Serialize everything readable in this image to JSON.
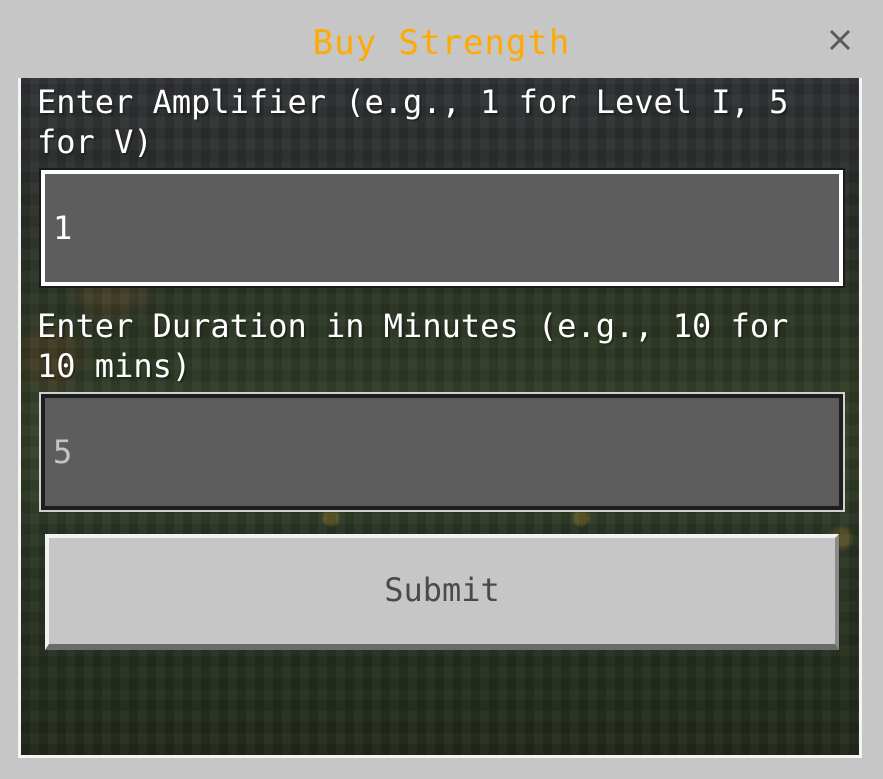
{
  "dialog": {
    "title": "Buy Strength",
    "title_color": "#ffaa00",
    "close_icon": "close-icon"
  },
  "form": {
    "amplifier": {
      "label": "Enter Amplifier (e.g., 1 for Level I, 5 for V)",
      "value": "1"
    },
    "duration": {
      "label": "Enter Duration in Minutes (e.g., 10 for 10 mins)",
      "value": "5"
    },
    "submit_label": "Submit"
  }
}
